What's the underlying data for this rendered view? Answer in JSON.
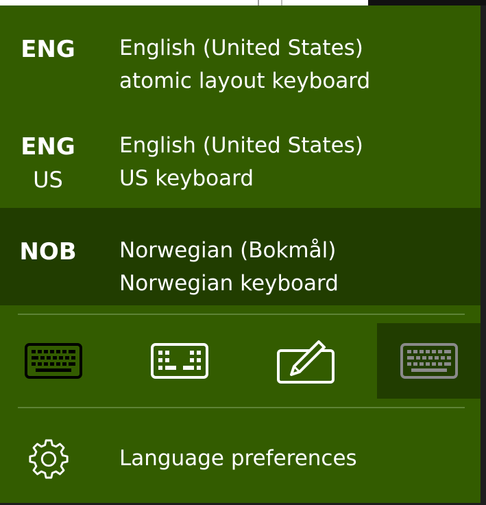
{
  "theme": {
    "panel_bg": "#335c00",
    "selected_bg": "#213d00",
    "divider": "#5e8336",
    "icon_disabled": "#8a8a8a"
  },
  "languages": [
    {
      "code": "ENG",
      "sub": "",
      "name": "English (United States)",
      "layout": "atomic layout keyboard",
      "selected": false
    },
    {
      "code": "ENG",
      "sub": "US",
      "name": "English (United States)",
      "layout": "US keyboard",
      "selected": false
    },
    {
      "code": "NOB",
      "sub": "",
      "name": "Norwegian (Bokmål)",
      "layout": "Norwegian keyboard",
      "selected": true
    }
  ],
  "toolbar": [
    {
      "icon": "keyboard-icon",
      "active": false
    },
    {
      "icon": "keyboard-split-icon",
      "active": false
    },
    {
      "icon": "handwriting-icon",
      "active": false
    },
    {
      "icon": "keyboard-disabled-icon",
      "active": true
    }
  ],
  "preferences": {
    "icon": "gear-icon",
    "label": "Language preferences"
  }
}
